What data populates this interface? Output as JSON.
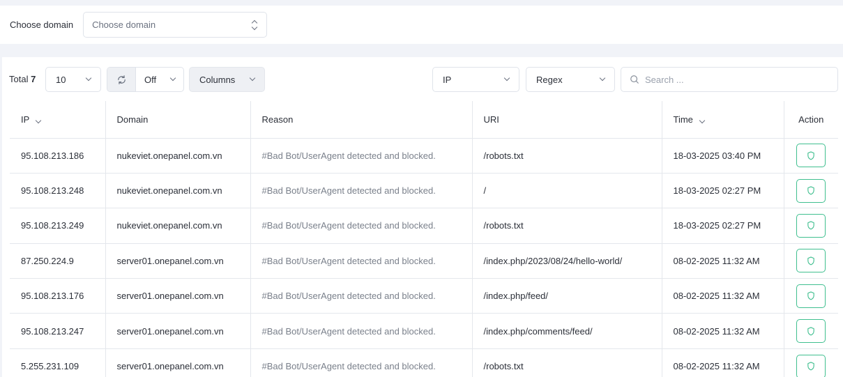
{
  "filter": {
    "label": "Choose domain",
    "placeholder": "Choose domain"
  },
  "toolbar": {
    "total_label": "Total",
    "total_count": "7",
    "page_size": "10",
    "auto_refresh": "Off",
    "columns_label": "Columns",
    "field_select": "IP",
    "mode_select": "Regex",
    "search_placeholder": "Search ..."
  },
  "table": {
    "headers": {
      "ip": "IP",
      "domain": "Domain",
      "reason": "Reason",
      "uri": "URI",
      "time": "Time",
      "action": "Action"
    },
    "rows": [
      {
        "ip": "95.108.213.186",
        "domain": "nukeviet.onepanel.com.vn",
        "reason": "#Bad Bot/UserAgent detected and blocked.",
        "uri": "/robots.txt",
        "time": "18-03-2025 03:40 PM"
      },
      {
        "ip": "95.108.213.248",
        "domain": "nukeviet.onepanel.com.vn",
        "reason": "#Bad Bot/UserAgent detected and blocked.",
        "uri": "/",
        "time": "18-03-2025 02:27 PM"
      },
      {
        "ip": "95.108.213.249",
        "domain": "nukeviet.onepanel.com.vn",
        "reason": "#Bad Bot/UserAgent detected and blocked.",
        "uri": "/robots.txt",
        "time": "18-03-2025 02:27 PM"
      },
      {
        "ip": "87.250.224.9",
        "domain": "server01.onepanel.com.vn",
        "reason": "#Bad Bot/UserAgent detected and blocked.",
        "uri": "/index.php/2023/08/24/hello-world/",
        "time": "08-02-2025 11:32 AM"
      },
      {
        "ip": "95.108.213.176",
        "domain": "server01.onepanel.com.vn",
        "reason": "#Bad Bot/UserAgent detected and blocked.",
        "uri": "/index.php/feed/",
        "time": "08-02-2025 11:32 AM"
      },
      {
        "ip": "95.108.213.247",
        "domain": "server01.onepanel.com.vn",
        "reason": "#Bad Bot/UserAgent detected and blocked.",
        "uri": "/index.php/comments/feed/",
        "time": "08-02-2025 11:32 AM"
      },
      {
        "ip": "5.255.231.109",
        "domain": "server01.onepanel.com.vn",
        "reason": "#Bad Bot/UserAgent detected and blocked.",
        "uri": "/robots.txt",
        "time": "08-02-2025 11:32 AM"
      }
    ],
    "row_action_icon": "shield-icon"
  },
  "colors": {
    "accent": "#3fbf8f",
    "background": "#f1f3f8",
    "border": "#e4e7ec"
  }
}
